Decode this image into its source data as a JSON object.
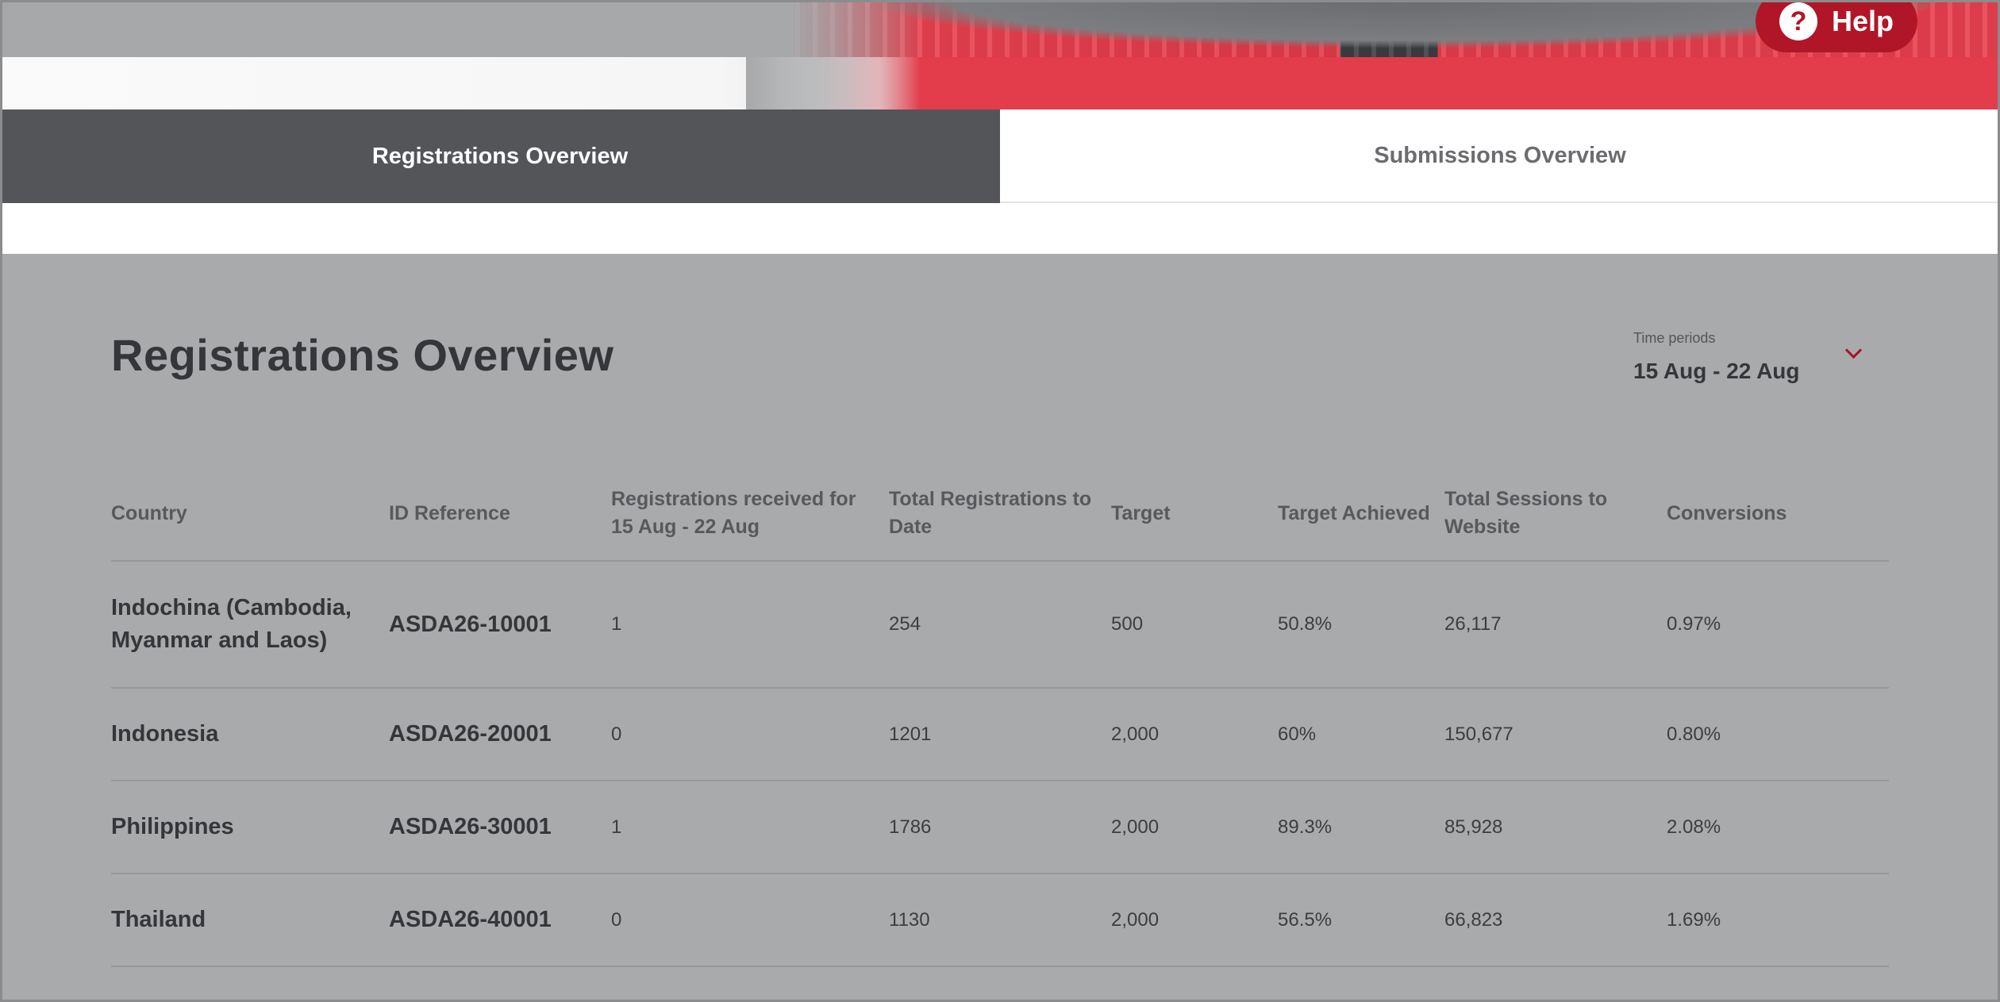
{
  "help": {
    "icon": "?",
    "label": "Help"
  },
  "tabs": [
    {
      "label": "Registrations Overview",
      "active": true
    },
    {
      "label": "Submissions Overview",
      "active": false
    }
  ],
  "page_title": "Registrations Overview",
  "time_period": {
    "label": "Time periods",
    "value": "15 Aug - 22 Aug"
  },
  "table": {
    "headers": [
      "Country",
      "ID Reference",
      "Registrations received for 15 Aug - 22 Aug",
      "Total Registrations to Date",
      "Target",
      "Target Achieved",
      "Total Sessions to Website",
      "Conversions"
    ],
    "rows": [
      [
        "Indochina (Cambodia, Myanmar and Laos)",
        "ASDA26-10001",
        "1",
        "254",
        "500",
        "50.8%",
        "26,117",
        "0.97%"
      ],
      [
        "Indonesia",
        "ASDA26-20001",
        "0",
        "1201",
        "2,000",
        "60%",
        "150,677",
        "0.80%"
      ],
      [
        "Philippines",
        "ASDA26-30001",
        "1",
        "1786",
        "2,000",
        "89.3%",
        "85,928",
        "2.08%"
      ],
      [
        "Thailand",
        "ASDA26-40001",
        "0",
        "1130",
        "2,000",
        "56.5%",
        "66,823",
        "1.69%"
      ]
    ]
  },
  "colors": {
    "overlay_grey": "#a9aaac",
    "active_tab": "#535559",
    "accent_red": "#b01628"
  }
}
